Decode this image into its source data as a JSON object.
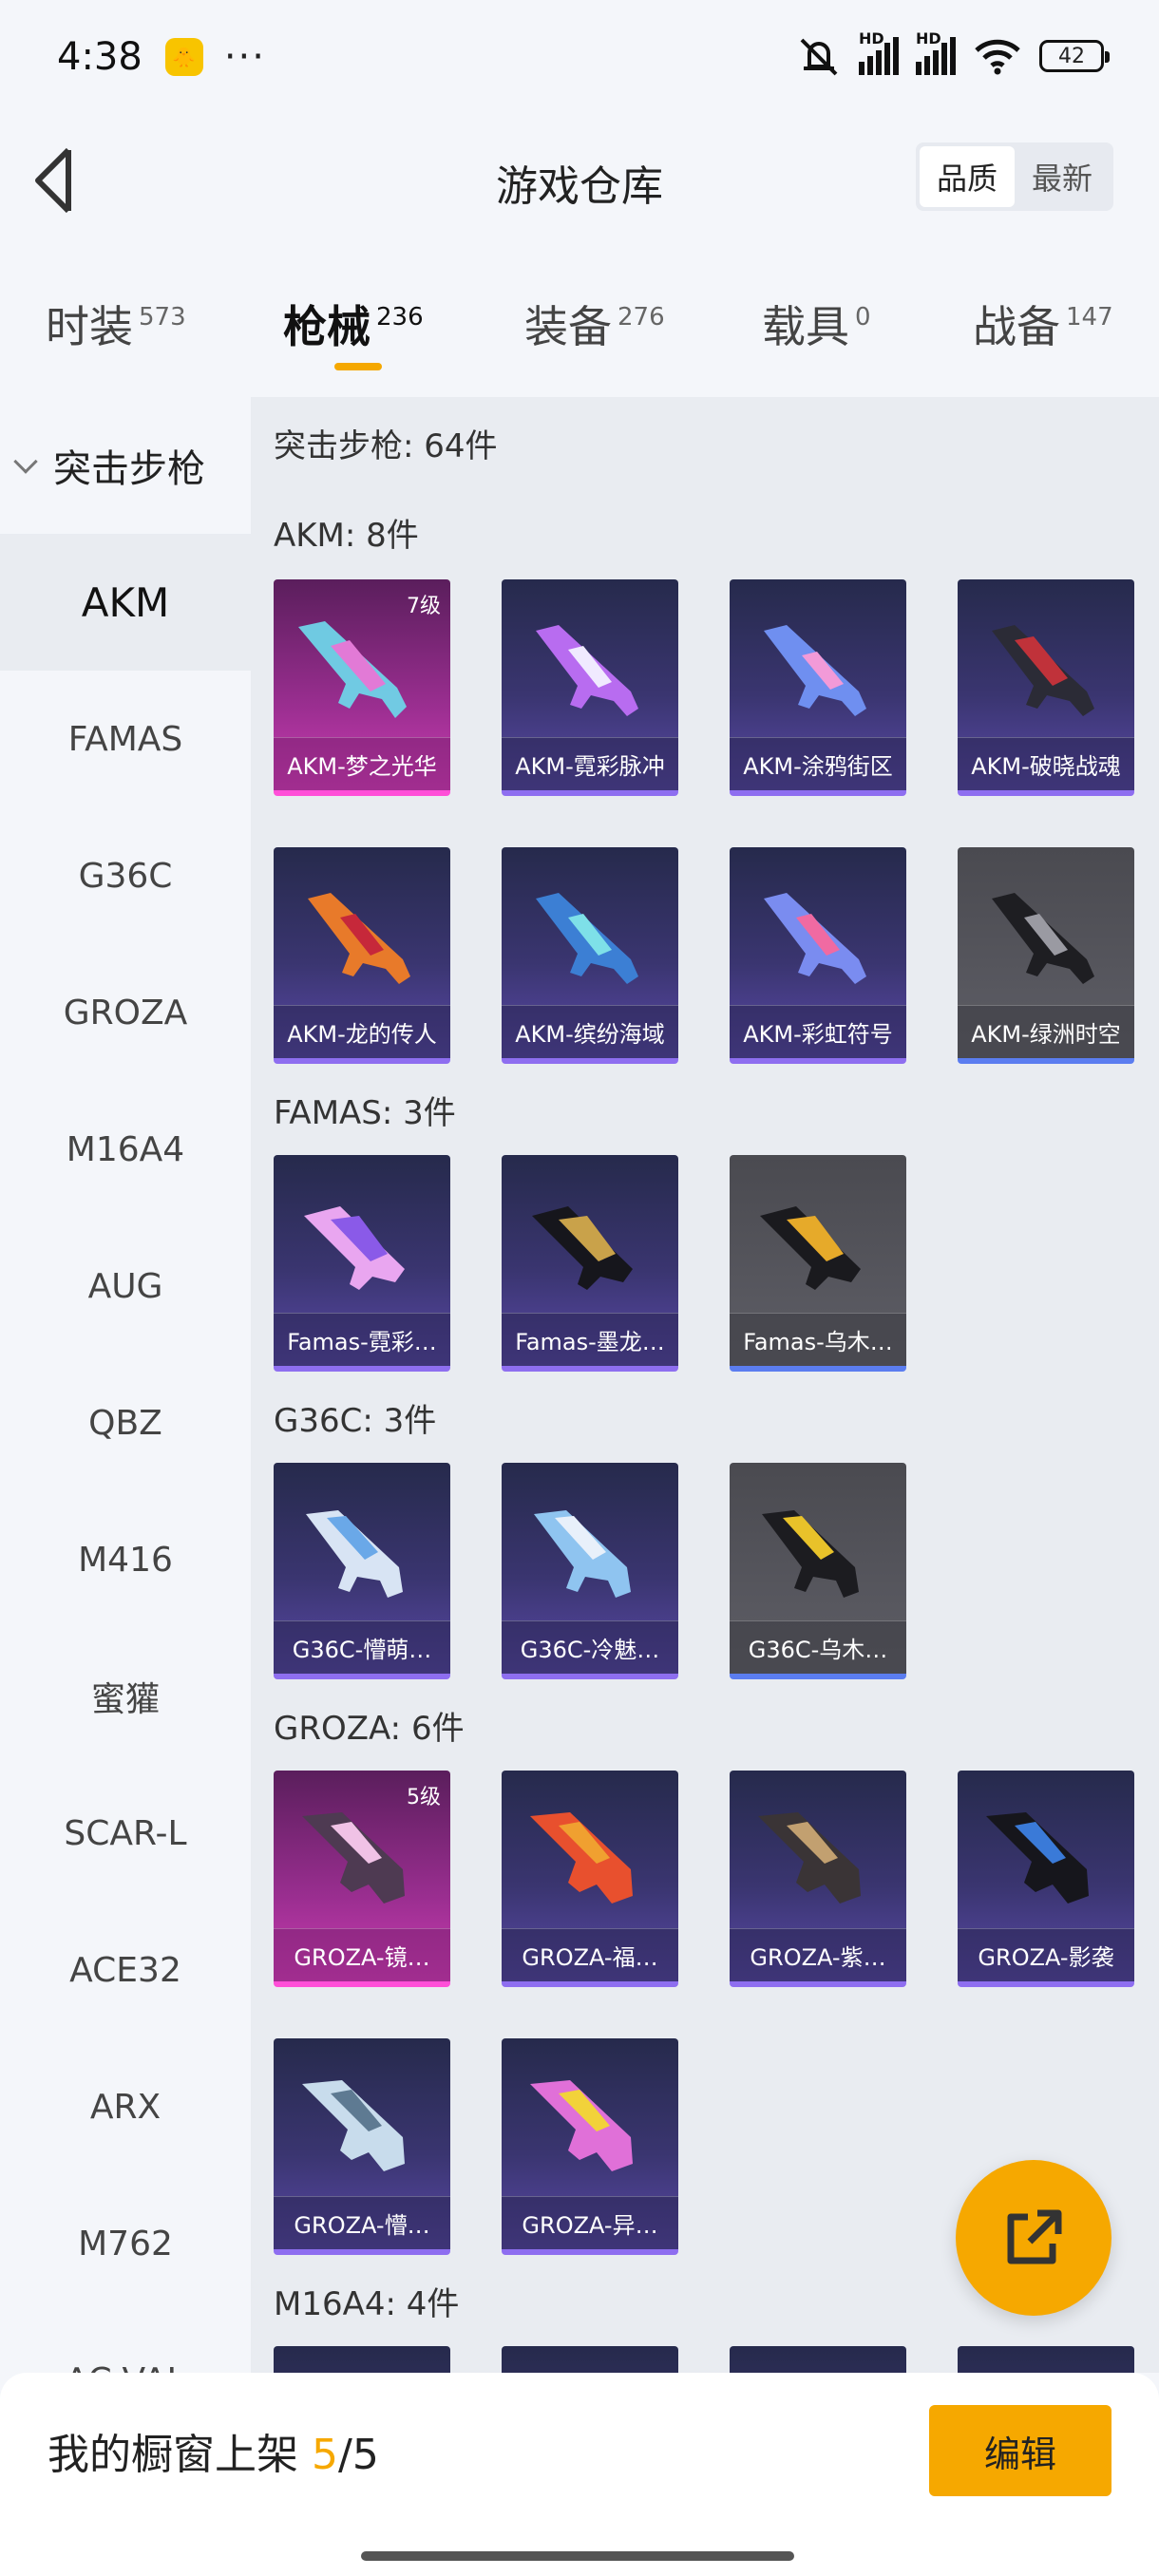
{
  "status": {
    "time": "4:38",
    "more": "···",
    "hd1": "HD",
    "hd2": "HD",
    "battery": "42"
  },
  "header": {
    "title": "游戏仓库",
    "sort_quality": "品质",
    "sort_newest": "最新"
  },
  "tabs": [
    {
      "label": "时装",
      "count": "573"
    },
    {
      "label": "枪械",
      "count": "236"
    },
    {
      "label": "装备",
      "count": "276"
    },
    {
      "label": "载具",
      "count": "0"
    },
    {
      "label": "战备",
      "count": "147"
    }
  ],
  "sidenav": {
    "group": "突击步枪",
    "items": [
      "AKM",
      "FAMAS",
      "G36C",
      "GROZA",
      "M16A4",
      "AUG",
      "QBZ",
      "M416",
      "蜜獾",
      "SCAR-L",
      "ACE32",
      "ARX",
      "M762",
      "AC-VAL"
    ]
  },
  "content": {
    "category_summary": "突击步枪: 64件",
    "sections": [
      {
        "header": "AKM: 8件",
        "items": [
          {
            "name": "AKM-梦之光华",
            "level": "7级"
          },
          {
            "name": "AKM-霓彩脉冲"
          },
          {
            "name": "AKM-涂鸦街区"
          },
          {
            "name": "AKM-破晓战魂"
          },
          {
            "name": "AKM-龙的传人"
          },
          {
            "name": "AKM-缤纷海域"
          },
          {
            "name": "AKM-彩虹符号"
          },
          {
            "name": "AKM-绿洲时空"
          }
        ]
      },
      {
        "header": "FAMAS: 3件",
        "items": [
          {
            "name": "Famas-霓彩…"
          },
          {
            "name": "Famas-墨龙…"
          },
          {
            "name": "Famas-乌木…"
          }
        ]
      },
      {
        "header": "G36C: 3件",
        "items": [
          {
            "name": "G36C-懵萌…"
          },
          {
            "name": "G36C-冷魅…"
          },
          {
            "name": "G36C-乌木…"
          }
        ]
      },
      {
        "header": "GROZA: 6件",
        "items": [
          {
            "name": "GROZA-镜…",
            "level": "5级"
          },
          {
            "name": "GROZA-福…"
          },
          {
            "name": "GROZA-紫…"
          },
          {
            "name": "GROZA-影袭"
          },
          {
            "name": "GROZA-懵…"
          },
          {
            "name": "GROZA-异…"
          }
        ]
      },
      {
        "header": "M16A4: 4件",
        "items": []
      }
    ]
  },
  "bottom": {
    "shelf_prefix": "我的橱窗上架 ",
    "shelf_current": "5",
    "shelf_total": "/5",
    "edit_label": "编辑"
  }
}
